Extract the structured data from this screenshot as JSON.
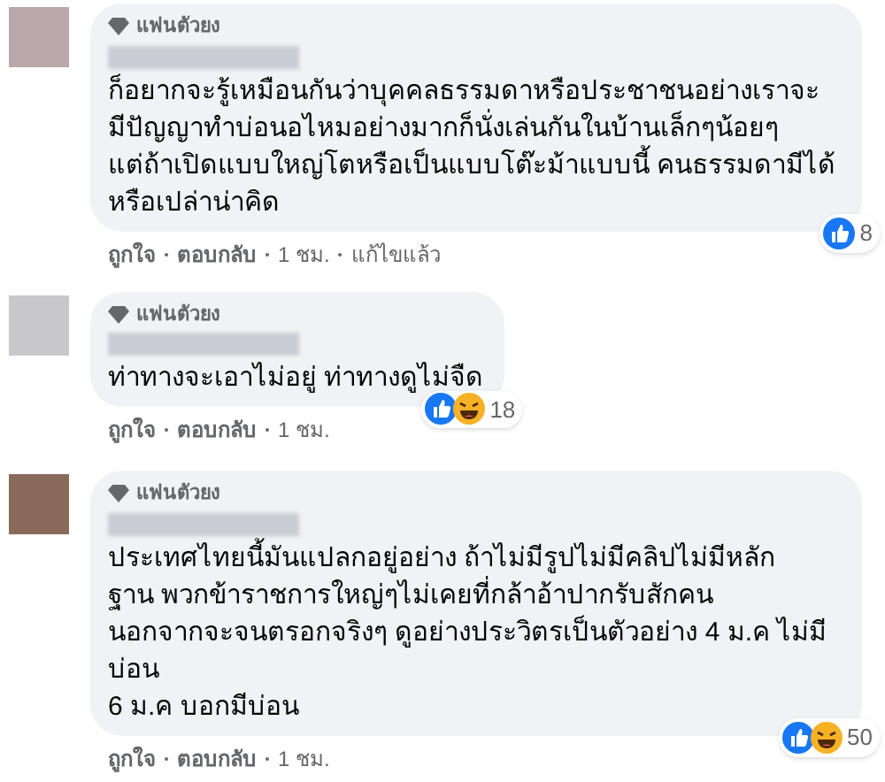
{
  "comments": [
    {
      "badge": "แฟนตัวยง",
      "text": "ก็อยากจะรู้เหมือนกันว่าบุคคลธรรมดาหรือประชาชนอย่างเราจะ\nมีปัญญาทำบ่อนอไหมอย่างมากก็นั่งเล่นกันในบ้านเล็กๆน้อยๆ\nแต่ถ้าเปิดแบบใหญ่โตหรือเป็นแบบโต๊ะม้าแบบนี้ คนธรรมดามีได้\nหรือเปล่าน่าคิด",
      "wide": true,
      "reactions": [
        {
          "kind": "like"
        }
      ],
      "reaction_count": "8",
      "actions": [
        "ถูกใจ",
        "ตอบกลับ",
        "1 ชม.",
        "แก้ไขแล้ว"
      ]
    },
    {
      "badge": "แฟนตัวยง",
      "text": "ท่าทางจะเอาไม่อยู่ ท่าทางดูไม่จืด",
      "wide": false,
      "reactions": [
        {
          "kind": "like"
        },
        {
          "kind": "haha"
        }
      ],
      "reaction_count": "18",
      "actions": [
        "ถูกใจ",
        "ตอบกลับ",
        "1 ชม."
      ]
    },
    {
      "badge": "แฟนตัวยง",
      "text": "ประเทศไทยนี้มันแปลกอยู่อย่าง ถ้าไม่มีรูปไม่มีคลิปไม่มีหลัก\nฐาน พวกข้าราชการใหญ่ๆไม่เคยที่กล้าอ้าปากรับสักคน\nนอกจากจะจนตรอกจริงๆ ดูอย่างประวิตรเป็นตัวอย่าง 4 ม.ค ไม่มี\nบ่อน\n6 ม.ค บอกมีบ่อน",
      "wide": true,
      "reactions": [
        {
          "kind": "like"
        },
        {
          "kind": "haha"
        }
      ],
      "reaction_count": "50",
      "actions": [
        "ถูกใจ",
        "ตอบกลับ",
        "1 ชม."
      ]
    }
  ]
}
